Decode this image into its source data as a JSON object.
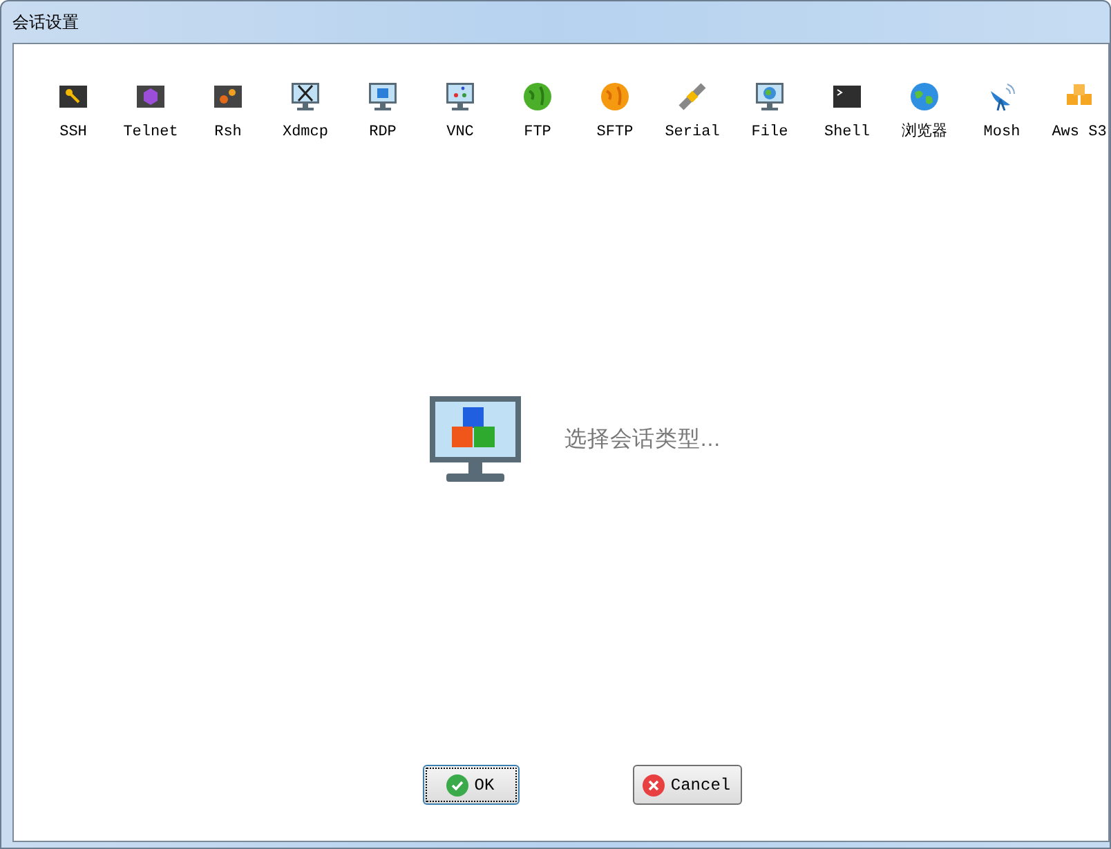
{
  "window": {
    "title": "会话设置"
  },
  "session_types": [
    {
      "label": "SSH",
      "kind": "key"
    },
    {
      "label": "Telnet",
      "kind": "gem"
    },
    {
      "label": "Rsh",
      "kind": "gears"
    },
    {
      "label": "Xdmcp",
      "kind": "xmonitor"
    },
    {
      "label": "RDP",
      "kind": "winmonitor"
    },
    {
      "label": "VNC",
      "kind": "vncmonitor"
    },
    {
      "label": "FTP",
      "kind": "greenglobe"
    },
    {
      "label": "SFTP",
      "kind": "orangeglobe"
    },
    {
      "label": "Serial",
      "kind": "plug"
    },
    {
      "label": "File",
      "kind": "globemonitor"
    },
    {
      "label": "Shell",
      "kind": "terminal"
    },
    {
      "label": "浏览器",
      "kind": "earth"
    },
    {
      "label": "Mosh",
      "kind": "dish"
    },
    {
      "label": "Aws S3",
      "kind": "cubes"
    }
  ],
  "prompt": "选择会话类型...",
  "buttons": [
    {
      "label": "OK",
      "kind": "ok",
      "focused": true
    },
    {
      "label": "Cancel",
      "kind": "cancel",
      "focused": false
    }
  ]
}
